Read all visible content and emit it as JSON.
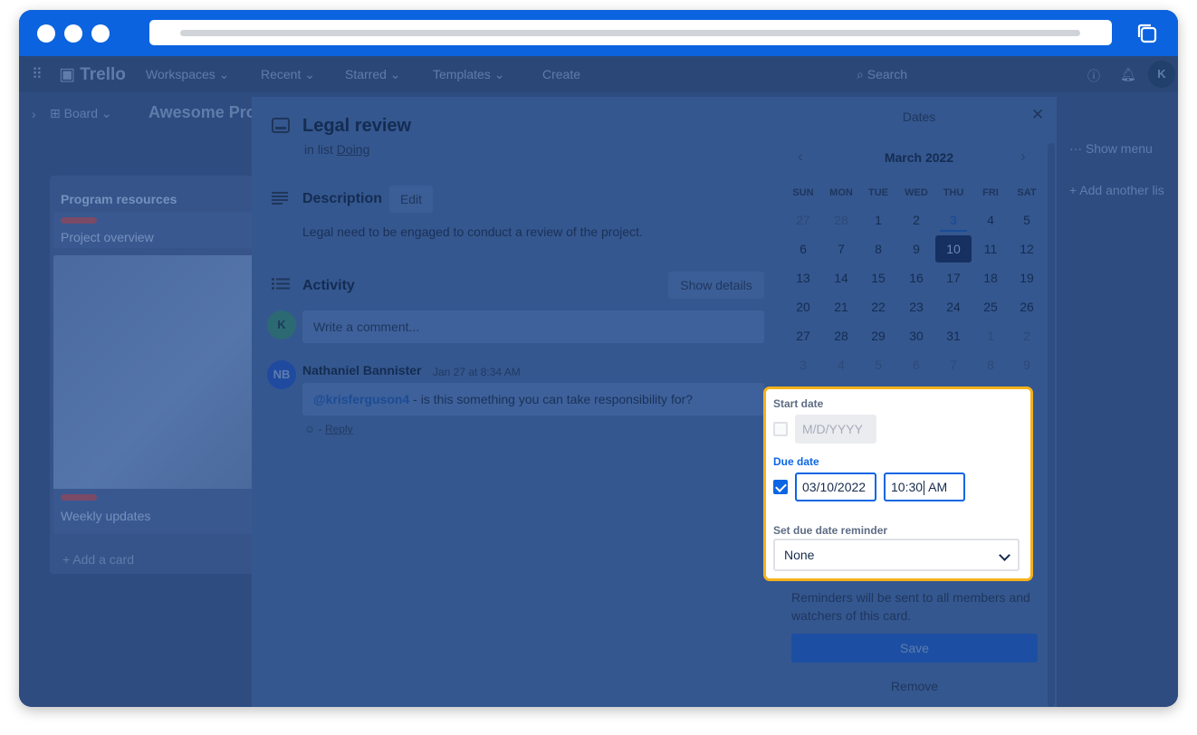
{
  "browser": {
    "url": ""
  },
  "nav": {
    "logo": "Trello",
    "workspaces": "Workspaces",
    "recent": "Recent",
    "starred": "Starred",
    "templates": "Templates",
    "create": "Create",
    "search": "Search",
    "avatar": "K"
  },
  "board": {
    "view_button": "Board",
    "title": "Awesome Pro",
    "show_menu": "Show menu",
    "add_list": "Add another lis"
  },
  "list": {
    "title": "Program resources",
    "cards": [
      "Project overview",
      "Weekly updates"
    ],
    "add_card": "Add a card"
  },
  "card": {
    "title": "Legal review",
    "in_list_prefix": "in list",
    "list_name": "Doing",
    "description_heading": "Description",
    "edit_label": "Edit",
    "description": "Legal need to be engaged to conduct a review of the project.",
    "activity_heading": "Activity",
    "show_details": "Show details",
    "comment_placeholder": "Write a comment...",
    "user_avatar": "K",
    "comment": {
      "avatar": "NB",
      "author": "Nathaniel Bannister",
      "time": "Jan 27 at 8:34 AM",
      "mention": "@krisferguson4",
      "text": " - is this something you can take responsibility for?",
      "reply": "Reply",
      "separator": "-"
    }
  },
  "dates": {
    "title": "Dates",
    "month": "March 2022",
    "weekdays": [
      "SUN",
      "MON",
      "TUE",
      "WED",
      "THU",
      "FRI",
      "SAT"
    ],
    "weeks": [
      [
        "27",
        "28",
        "1",
        "2",
        "3",
        "4",
        "5"
      ],
      [
        "6",
        "7",
        "8",
        "9",
        "10",
        "11",
        "12"
      ],
      [
        "13",
        "14",
        "15",
        "16",
        "17",
        "18",
        "19"
      ],
      [
        "20",
        "21",
        "22",
        "23",
        "24",
        "25",
        "26"
      ],
      [
        "27",
        "28",
        "29",
        "30",
        "31",
        "1",
        "2"
      ],
      [
        "3",
        "4",
        "5",
        "6",
        "7",
        "8",
        "9"
      ]
    ],
    "today": "3",
    "selected": "10",
    "start_date_label": "Start date",
    "start_date_placeholder": "M/D/YYYY",
    "start_date_checked": false,
    "due_date_label": "Due date",
    "due_date_checked": true,
    "due_date_value": "03/10/2022",
    "due_time_before_caret": "10:30",
    "due_time_after_caret": " AM",
    "reminder_label": "Set due date reminder",
    "reminder_value": "None",
    "reminder_note": "Reminders will be sent to all members and watchers of this card.",
    "save_label": "Save",
    "remove_label": "Remove"
  },
  "colors": {
    "browser_bar": "#0b63df",
    "highlight_border": "#f6b21a",
    "accent_blue": "#0c66e4"
  }
}
